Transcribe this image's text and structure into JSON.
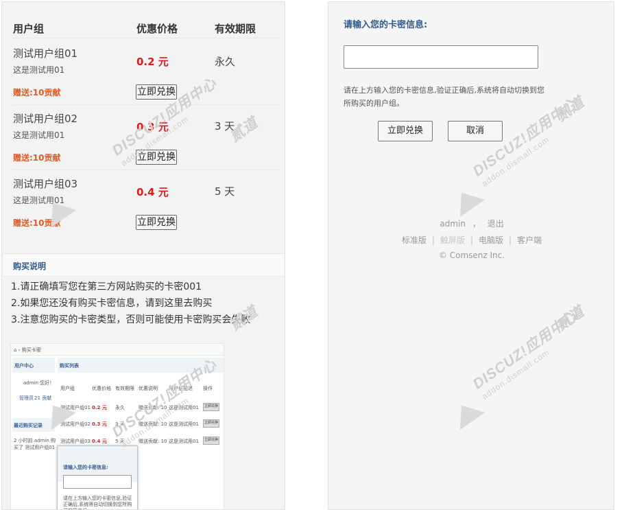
{
  "table": {
    "headers": [
      "用户组",
      "优惠价格",
      "有效期限"
    ],
    "rows": [
      {
        "name": "测试用户组01",
        "desc": "这是测试用01",
        "price": "0.2 元",
        "validity": "永久",
        "gift": "赠送:10贡献",
        "button": "立即兑换"
      },
      {
        "name": "测试用户组02",
        "desc": "这是测试用01",
        "price": "0.3 元",
        "validity": "3 天",
        "gift": "赠送:10贡献",
        "button": "立即兑换"
      },
      {
        "name": "测试用户组03",
        "desc": "这是测试用01",
        "price": "0.4 元",
        "validity": "5 天",
        "gift": "赠送:10贡献",
        "button": "立即兑换"
      }
    ]
  },
  "notes": {
    "title": "购买说明",
    "items": [
      "1.请正确填写您在第三方网站购买的卡密001",
      "2.如果您还没有购买卡密信息，请到这里去购买",
      "3.注意您购买的卡密类型，否则可能使用卡密购买会失败"
    ]
  },
  "thumbnail": {
    "breadcrumb": "⌂ › 购买卡密",
    "sidebar_title": "用户中心",
    "user_line": "admin 您好！",
    "manage": "管理员",
    "contrib": "21 贡献",
    "record_title": "最近购买记录",
    "record_line": "2 小时前 admin 购买了 测试用户组01",
    "list_title": "购买列表",
    "headers": [
      "用户组",
      "优惠价格",
      "有效期限",
      "优惠说明",
      "用户组描述",
      "操作"
    ],
    "rows": [
      {
        "name": "测试用户组01",
        "price": "0.2 元",
        "validity": "永久",
        "gift": "赠送贡献: 10",
        "desc": "这是测试用01",
        "button": "立即兑换"
      },
      {
        "name": "测试用户组02",
        "price": "0.3 元",
        "validity": "3 天",
        "gift": "赠送贡献: 10",
        "desc": "这是测试用01",
        "button": "立即兑换"
      },
      {
        "name": "测试用户组03",
        "price": "0.4 元",
        "validity": "5 天",
        "gift": "赠送贡献: 10",
        "desc": "这是测试用01",
        "button": "立即兑换"
      }
    ],
    "modal_title": "请输入您的卡密信息:",
    "modal_help": "请在上方输入您的卡密信息,验证正确后,系统将自动切换到您所购买的用户组。"
  },
  "card": {
    "title": "请输入您的卡密信息:",
    "input_value": "",
    "help": "请在上方输入您的卡密信息,验证正确后,系统将自动切换到您所购买的用户组。",
    "submit": "立即兑换",
    "cancel": "取消"
  },
  "footer": {
    "user": "admin",
    "comma": "，",
    "logout": "退出",
    "links": [
      "标准版",
      "触屏版",
      "电脑版",
      "客户端"
    ],
    "copyright": "© Comsenz Inc."
  },
  "watermark": {
    "brand": "DISCUZ!应用中心",
    "site": "addon.dismall.com",
    "partner": "贰道"
  }
}
